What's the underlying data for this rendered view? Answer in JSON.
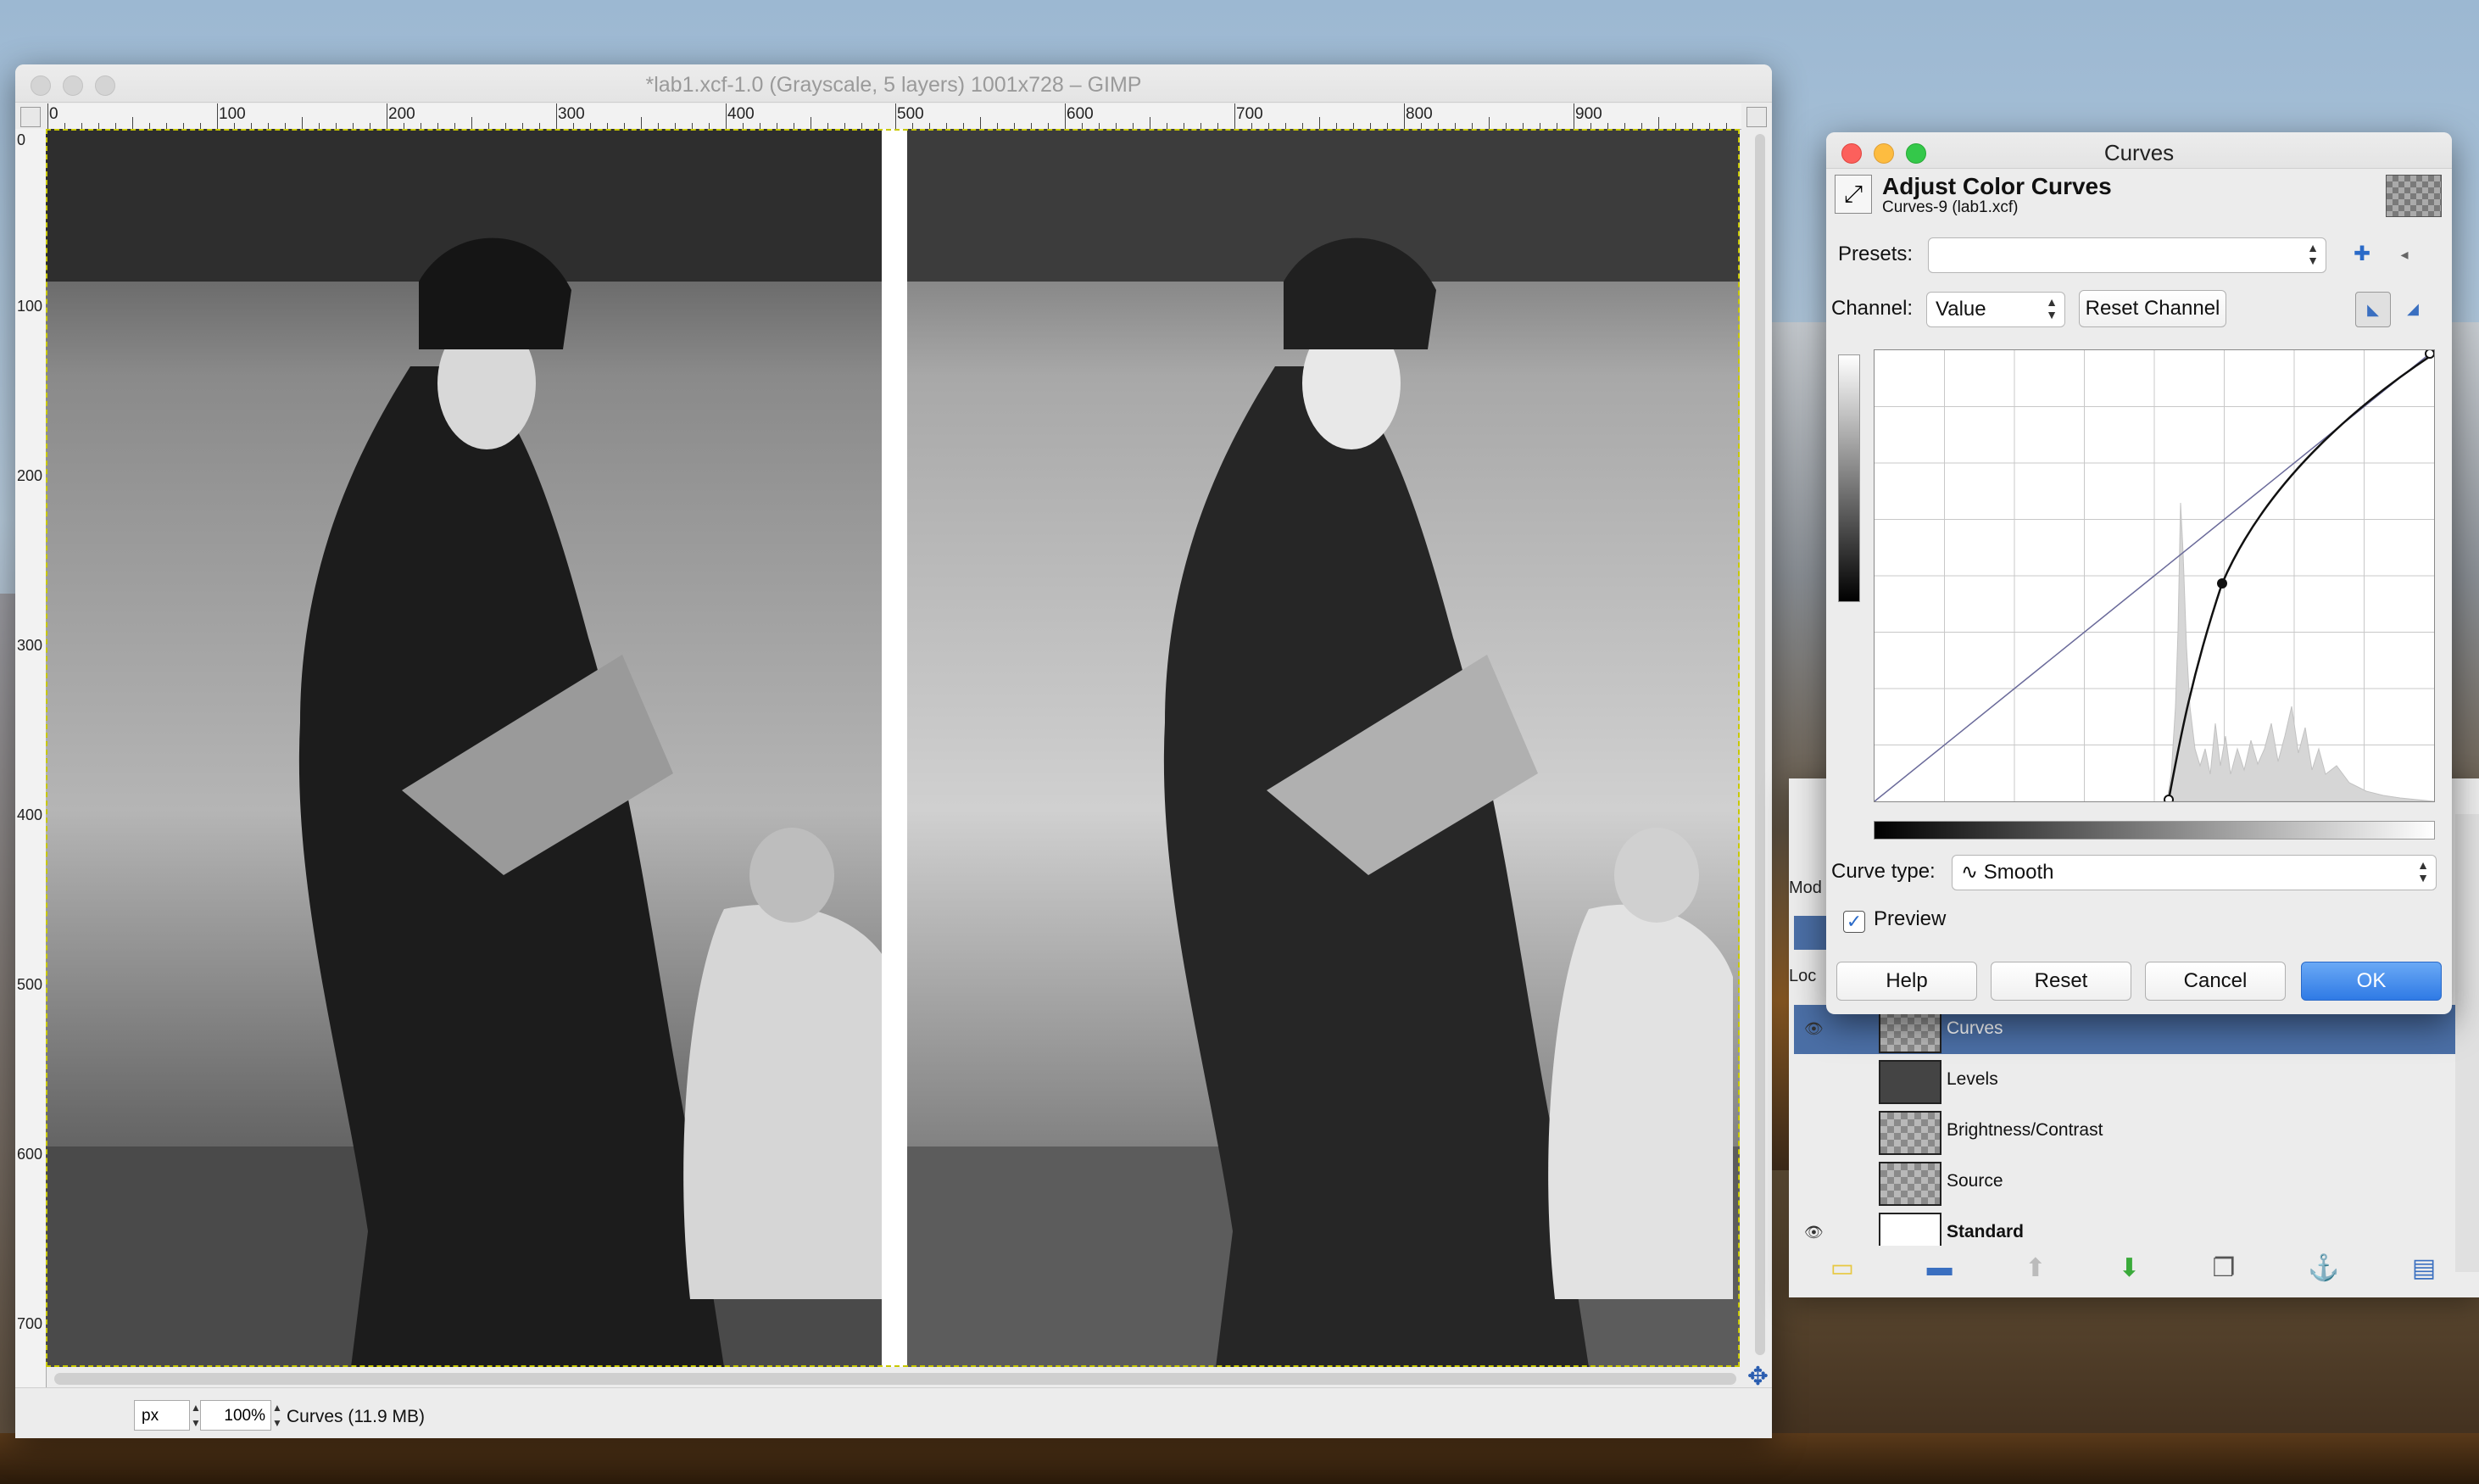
{
  "main_window": {
    "title": "*lab1.xcf-1.0 (Grayscale, 5 layers) 1001x728 – GIMP",
    "ruler_h": [
      "0",
      "100",
      "200",
      "300",
      "400",
      "500",
      "600",
      "700",
      "800",
      "900"
    ],
    "ruler_v": [
      "0",
      "100",
      "200",
      "300",
      "400",
      "500",
      "600",
      "700"
    ],
    "status": {
      "unit": "px",
      "zoom": "100%",
      "text": "Curves (11.9 MB)"
    }
  },
  "curves_dialog": {
    "window_title": "Curves",
    "heading": "Adjust Color Curves",
    "subheading": "Curves-9 (lab1.xcf)",
    "presets_label": "Presets:",
    "presets_value": "",
    "channel_label": "Channel:",
    "channel_value": "Value",
    "reset_channel": "Reset Channel",
    "curve_type_label": "Curve type:",
    "curve_type_value": "Smooth",
    "preview_label": "Preview",
    "preview_checked": true,
    "buttons": {
      "help": "Help",
      "reset": "Reset",
      "cancel": "Cancel",
      "ok": "OK"
    },
    "accent": "#2f7ae5"
  },
  "layers_dock": {
    "mode_label": "Mod",
    "lock_label": "Loc",
    "layers": [
      {
        "name": "Curves",
        "selected": true,
        "visible": true
      },
      {
        "name": "Levels",
        "selected": false,
        "visible": false
      },
      {
        "name": "Brightness/Contrast",
        "selected": false,
        "visible": false
      },
      {
        "name": "Source",
        "selected": false,
        "visible": false
      },
      {
        "name": "Standard",
        "selected": false,
        "visible": true
      }
    ]
  }
}
